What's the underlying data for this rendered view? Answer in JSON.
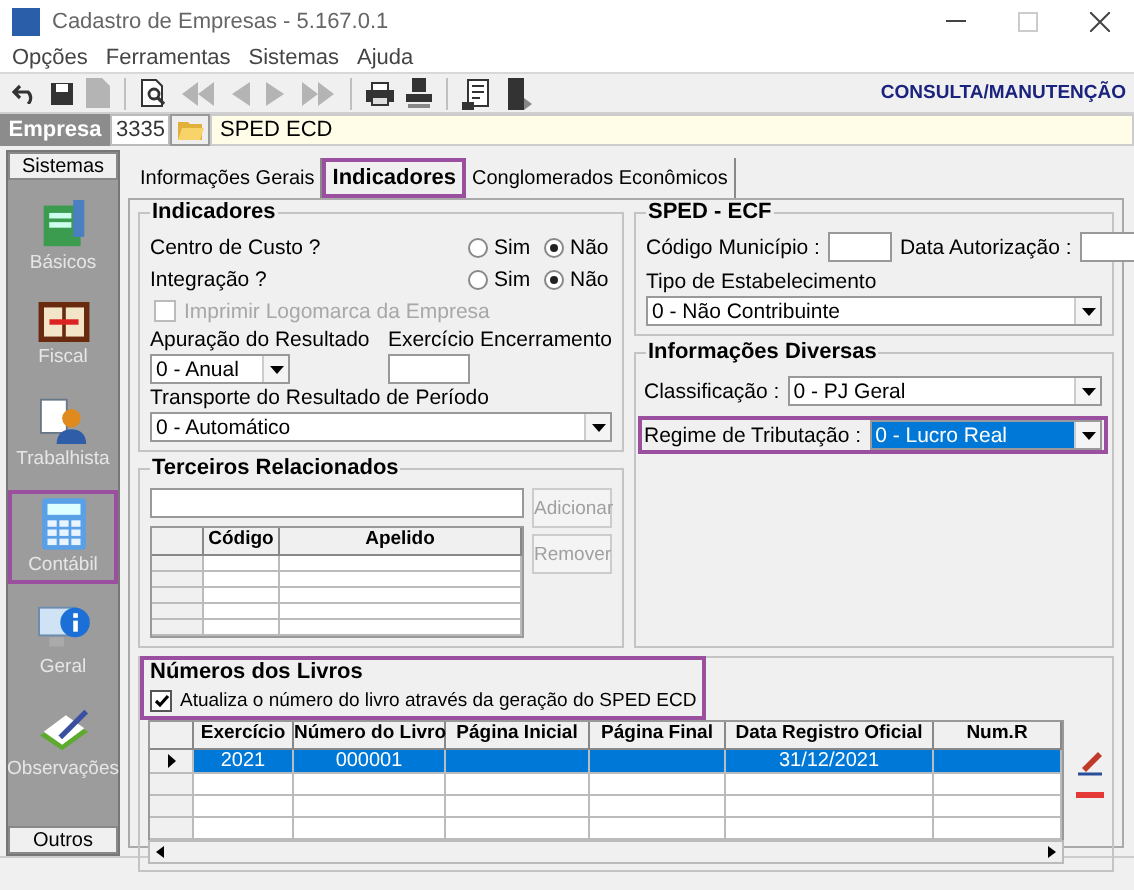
{
  "window": {
    "title": "Cadastro de Empresas - 5.167.0.1"
  },
  "menu": [
    "Opções",
    "Ferramentas",
    "Sistemas",
    "Ajuda"
  ],
  "toolbar": {
    "buttons": [
      {
        "kind": "undo",
        "disabled": false
      },
      {
        "kind": "save",
        "disabled": false
      },
      {
        "kind": "document",
        "disabled": true
      },
      {
        "kind": "preview",
        "disabled": false
      },
      {
        "kind": "first",
        "disabled": true
      },
      {
        "kind": "previous",
        "disabled": true
      },
      {
        "kind": "next",
        "disabled": true
      },
      {
        "kind": "last",
        "disabled": true
      },
      {
        "kind": "printer",
        "disabled": false
      },
      {
        "kind": "stamp",
        "disabled": false
      },
      {
        "kind": "report",
        "disabled": false
      },
      {
        "kind": "exit",
        "disabled": false
      }
    ],
    "mode": "CONSULTA/MANUTENÇÃO"
  },
  "company": {
    "label": "Empresa",
    "code": "3335",
    "name": "SPED ECD"
  },
  "sidebar": {
    "header": "Sistemas",
    "footer": "Outros",
    "items": [
      {
        "label": "Básicos",
        "kind": "basicos",
        "selected": false
      },
      {
        "label": "Fiscal",
        "kind": "fiscal",
        "selected": false
      },
      {
        "label": "Trabalhista",
        "kind": "trabalhista",
        "selected": false
      },
      {
        "label": "Contábil",
        "kind": "contabil",
        "selected": true
      },
      {
        "label": "Geral",
        "kind": "geral",
        "selected": false
      },
      {
        "label": "Observações",
        "kind": "observacoes",
        "selected": false
      }
    ]
  },
  "tabs": [
    {
      "label": "Informações Gerais",
      "selected": false,
      "highlighted": false
    },
    {
      "label": "Indicadores",
      "selected": true,
      "highlighted": true
    },
    {
      "label": "Conglomerados Econômicos",
      "selected": false,
      "highlighted": false
    }
  ],
  "indicadores": {
    "title": "Indicadores",
    "questions": [
      {
        "label": "Centro de Custo ?",
        "options": [
          {
            "label": "Sim",
            "selected": false
          },
          {
            "label": "Não",
            "selected": true
          }
        ]
      },
      {
        "label": "Integração ?",
        "options": [
          {
            "label": "Sim",
            "selected": false
          },
          {
            "label": "Não",
            "selected": true
          }
        ]
      }
    ],
    "logo_checkbox": {
      "label": "Imprimir Logomarca da Empresa",
      "checked": false,
      "disabled": true
    },
    "apuracao": {
      "label": "Apuração do Resultado",
      "value": "0 - Anual"
    },
    "exercicio": {
      "label": "Exercício Encerramento"
    },
    "transporte": {
      "label": "Transporte do Resultado de Período",
      "value": "0 - Automático"
    }
  },
  "terceiros": {
    "title": "Terceiros Relacionados",
    "buttons": [
      {
        "label": "Adicionar",
        "disabled": true
      },
      {
        "label": "Remover",
        "disabled": true
      }
    ],
    "columns": [
      "Código",
      "Apelido"
    ]
  },
  "sped_ecf": {
    "title": "SPED - ECF",
    "municipio_label": "Código Município :",
    "data_label": "Data Autorização :",
    "tipo": {
      "label": "Tipo de Estabelecimento",
      "value": "0 - Não Contribuinte"
    }
  },
  "diversas": {
    "title": "Informações Diversas",
    "fields": [
      {
        "label": "Classificação :",
        "value": "0 - PJ Geral",
        "focused": false,
        "highlighted": false
      },
      {
        "label": "Regime de Tributação :",
        "value": "0 - Lucro Real",
        "focused": true,
        "highlighted": true
      }
    ]
  },
  "livros": {
    "title": "Números dos Livros",
    "highlighted": true,
    "checkbox": {
      "label": "Atualiza o número do livro através da geração do SPED ECD",
      "checked": true
    },
    "columns": [
      "Exercício",
      "Número do Livro",
      "Página Inicial",
      "Página Final",
      "Data Registro Oficial",
      "Num.R"
    ],
    "rows": [
      {
        "selected": true,
        "cells": [
          "2021",
          "000001",
          null,
          null,
          "31/12/2021",
          null
        ]
      }
    ]
  }
}
